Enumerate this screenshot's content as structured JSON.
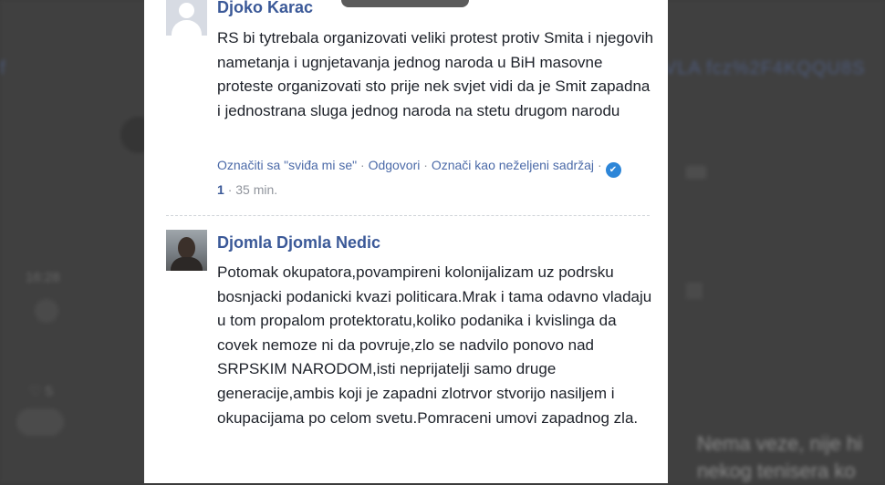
{
  "background": {
    "link_left": "f",
    "link_right": "VLA fcz%2F4KQQU8S",
    "time": "16:28",
    "like": "♡ 5",
    "right_text_line1": "Nema veze, nije hi",
    "right_text_line2": "nekog tenisera ko"
  },
  "comments": [
    {
      "author": "Djoko Karac",
      "text": "RS bi tytrebala organizovati veliki protest protiv Smita i njegovih nametanja i ugnjetavanja jednog naroda u BiH masovne proteste organizovati sto prije nek svjet vidi da je Smit zapadna i jednostrana sluga jednog naroda na stetu drugom narodu",
      "actions": {
        "like": "Označiti sa \"sviđa mi se\"",
        "reply": "Odgovori",
        "report": "Označi kao neželjeni sadržaj",
        "reaction_count": "1",
        "time": "35 min."
      }
    },
    {
      "author": "Djomla Djomla Nedic",
      "text": "Potomak okupatora,povampireni kolonijalizam uz podrsku bosnjacki podanicki kvazi politicara.Mrak i tama odavno vladaju u tom propalom protektoratu,koliko podanika i kvislinga da covek nemoze ni da povruje,zlo se nadvilo ponovo nad SRPSKIM NARODOM,isti neprijatelji samo druge generacije,ambis koji je zapadni zlotrvor stvorijo nasiljem i okupacijama po celom svetu.Pomraceni umovi zapadnog zla."
    }
  ],
  "colors": {
    "author": "#3b5998",
    "text": "#1d2129",
    "meta": "#90949c",
    "link": "#4b6aa8"
  },
  "icons": {
    "reaction": "like-reaction-icon",
    "default_avatar": "default-avatar-icon"
  }
}
